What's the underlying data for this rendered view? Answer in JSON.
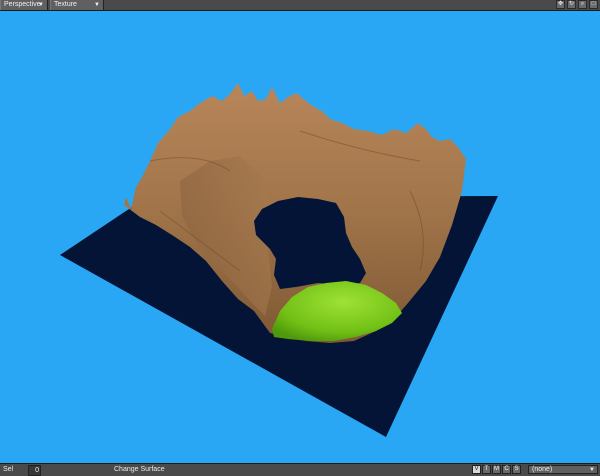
{
  "viewport_header": {
    "view_mode": "Perspective",
    "render_mode": "Texture",
    "icons": [
      "move-view-icon",
      "rotate-view-icon",
      "zoom-view-icon",
      "maximize-view-icon"
    ]
  },
  "status_bar": {
    "sel_label": "Sel",
    "sel_count": "0",
    "action_text": "Change Surface",
    "modes": [
      {
        "label": "V",
        "active": true
      },
      {
        "label": "T",
        "active": false
      },
      {
        "label": "M",
        "active": false
      },
      {
        "label": "C",
        "active": false
      },
      {
        "label": "S",
        "active": false
      }
    ],
    "surface_value": "(none)"
  },
  "colors": {
    "background": "#2aa7f4",
    "ground_plane": "#041436",
    "terrain": "#a07449",
    "pool": "#7ecb1c",
    "ui_panel": "#4a4a4a"
  }
}
